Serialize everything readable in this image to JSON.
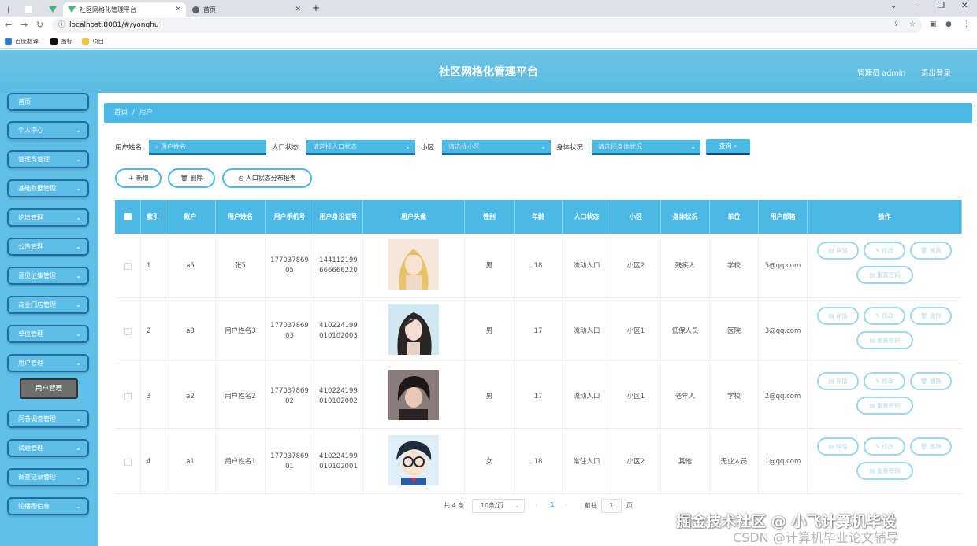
{
  "browser": {
    "tabs": [
      {
        "title": ""
      },
      {
        "title": ""
      },
      {
        "title": ""
      },
      {
        "title": "社区网格化管理平台"
      },
      {
        "title": "首页"
      }
    ],
    "url": "localhost:8081/#/yonghu",
    "bookmarks": [
      {
        "label": "百度翻译",
        "color": "#2f7bd9"
      },
      {
        "label": "图标",
        "color": "#111111"
      },
      {
        "label": "项目",
        "color": "#f3c440"
      }
    ]
  },
  "header": {
    "title": "社区网格化管理平台",
    "admin_label": "管理员 admin",
    "logout": "退出登录"
  },
  "sidebar": {
    "items": [
      {
        "label": "首页",
        "has_chevron": false
      },
      {
        "label": "个人中心",
        "has_chevron": true
      },
      {
        "label": "管理员管理",
        "has_chevron": true
      },
      {
        "label": "基础数据管理",
        "has_chevron": true
      },
      {
        "label": "论坛管理",
        "has_chevron": true
      },
      {
        "label": "公告管理",
        "has_chevron": true
      },
      {
        "label": "意见征集管理",
        "has_chevron": true
      },
      {
        "label": "商业门店管理",
        "has_chevron": true
      },
      {
        "label": "单位管理",
        "has_chevron": true
      },
      {
        "label": "用户管理",
        "has_chevron": true
      },
      {
        "label": "问卷调查管理",
        "has_chevron": true
      },
      {
        "label": "试题管理",
        "has_chevron": true
      },
      {
        "label": "调查记录管理",
        "has_chevron": true
      },
      {
        "label": "轮播图信息",
        "has_chevron": true
      }
    ],
    "active_sub": "用户管理"
  },
  "breadcrumb": {
    "home": "首页",
    "current": "用户"
  },
  "filters": {
    "name_label": "用户姓名",
    "name_placeholder": "用户姓名",
    "pop_label": "人口状态",
    "pop_placeholder": "请选择人口状态",
    "area_label": "小区",
    "area_placeholder": "请选择小区",
    "health_label": "身体状况",
    "health_placeholder": "请选择身体状况",
    "query_button": "查询"
  },
  "actions": {
    "add": "新增",
    "delete": "删除",
    "report": "人口状态分布报表"
  },
  "table": {
    "columns": [
      "",
      "索引",
      "账户",
      "用户姓名",
      "用户手机号",
      "用户身份证号",
      "用户头像",
      "性别",
      "年龄",
      "人口状态",
      "小区",
      "身体状况",
      "单位",
      "用户邮箱",
      "操作"
    ],
    "rows": [
      {
        "index": "1",
        "account": "a5",
        "name": "张5",
        "phone": "17703786905",
        "phone_l1": "177037869",
        "phone_l2": "05",
        "id_l1": "144112199",
        "id_l2": "666666220",
        "gender": "男",
        "age": "18",
        "pop": "流动人口",
        "area": "小区2",
        "health": "残疾人",
        "unit": "学校",
        "email": "5@qq.com",
        "avatar": "anime-girl-blonde"
      },
      {
        "index": "2",
        "account": "a3",
        "name": "用户姓名3",
        "phone": "17703786903",
        "phone_l1": "177037869",
        "phone_l2": "03",
        "id_l1": "410224199",
        "id_l2": "010102003",
        "gender": "男",
        "age": "17",
        "pop": "流动人口",
        "area": "小区1",
        "health": "低保人员",
        "unit": "医院",
        "email": "3@qq.com",
        "avatar": "girl-dark-hair"
      },
      {
        "index": "3",
        "account": "a2",
        "name": "用户姓名2",
        "phone": "17703786902",
        "phone_l1": "177037869",
        "phone_l2": "02",
        "id_l1": "410224199",
        "id_l2": "010102002",
        "gender": "男",
        "age": "17",
        "pop": "流动人口",
        "area": "小区1",
        "health": "老年人",
        "unit": "学校",
        "email": "2@qq.com",
        "avatar": "boy-dark-hair"
      },
      {
        "index": "4",
        "account": "a1",
        "name": "用户姓名1",
        "phone": "17703786901",
        "phone_l1": "177037869",
        "phone_l2": "01",
        "id_l1": "410224199",
        "id_l2": "010102001",
        "gender": "女",
        "age": "18",
        "pop": "常住人口",
        "area": "小区2",
        "health": "其他",
        "unit": "无业人员",
        "email": "1@qq.com",
        "avatar": "cartoon-boy-glasses"
      }
    ],
    "row_actions": {
      "detail": "详情",
      "edit": "修改",
      "delete": "删除",
      "reset": "重置密码"
    }
  },
  "pagination": {
    "total": "共 4 条",
    "page_size": "10条/页",
    "prev": "‹",
    "current": "1",
    "next": "›",
    "goto_label": "前往",
    "goto_value": "1",
    "page_suffix": "页"
  },
  "watermarks": {
    "line1": "掘金技术社区 @ 小飞计算机毕设",
    "line2": "CSDN @计算机毕业论文辅导"
  },
  "colors": {
    "primary": "#4cb8e6",
    "header": "#5bbbe3",
    "sidebar": "#5fbfe6",
    "op_border": "#9ed6ee"
  }
}
